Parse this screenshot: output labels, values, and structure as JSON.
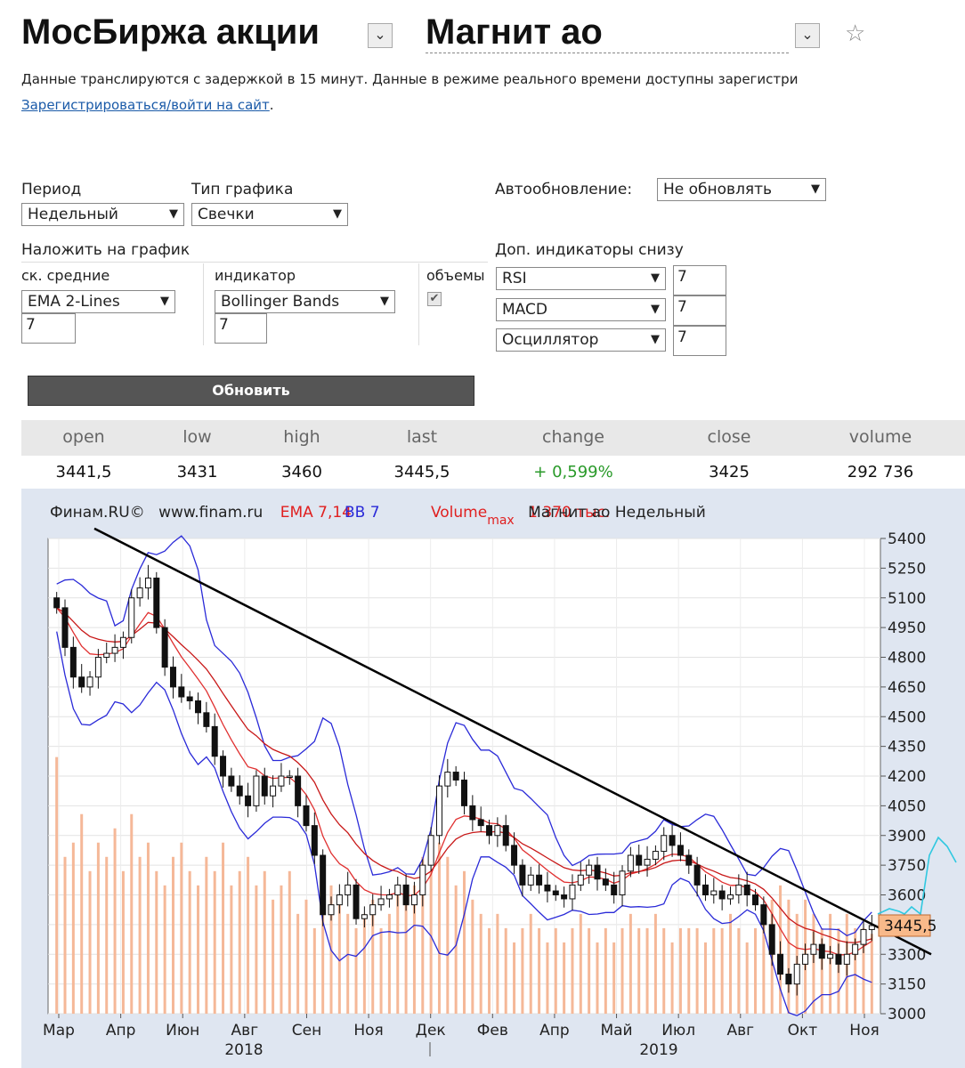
{
  "header": {
    "market_title": "МосБиржа акции",
    "ticker_title": "Магнит ао",
    "dropdown_glyph": "⌄",
    "star_glyph": "☆"
  },
  "notice": {
    "text": "Данные транслируются с задержкой в 15 минут. Данные в режиме реального времени доступны зарегистри",
    "link": "Зарегистрироваться/войти на сайт",
    "link_suffix": "."
  },
  "controls": {
    "period": {
      "label": "Период",
      "value": "Недельный"
    },
    "chart_type": {
      "label": "Тип графика",
      "value": "Свечки"
    },
    "autorefresh": {
      "label": "Автообновление:",
      "value": "Не обновлять"
    },
    "overlay_label": "Наложить на график",
    "ma": {
      "label": "ск. средние",
      "value": "EMA 2-Lines",
      "param": "7"
    },
    "indicator": {
      "label": "индикатор",
      "value": "Bollinger Bands",
      "param": "7"
    },
    "volumes": {
      "label": "объемы",
      "checked": true
    },
    "extra_label": "Доп. индикаторы снизу",
    "extra": [
      {
        "value": "RSI",
        "param": "7"
      },
      {
        "value": "MACD",
        "param": "7"
      },
      {
        "value": "Осциллятор",
        "param": "7"
      }
    ],
    "arrow": "▼",
    "refresh_button": "Обновить"
  },
  "quote": {
    "headers": [
      "open",
      "low",
      "high",
      "last",
      "change",
      "close",
      "volume"
    ],
    "values": [
      "3441,5",
      "3431",
      "3460",
      "3445,5",
      "+ 0,599%",
      "3425",
      "292 736"
    ],
    "change_color": "#2a9a2a"
  },
  "chart_legend": {
    "source": "Финам.RU©",
    "site": "www.finam.ru",
    "ema": "EMA 7,14",
    "bb": "BB 7",
    "volume": "Volume",
    "max": "max",
    "overlap_text": "1 370 тыс.",
    "instrument": "Магнит ао Недельный",
    "last_marker": "3445,5"
  },
  "chart_data": {
    "type": "candlestick",
    "y_ticks": [
      "5400",
      "5250",
      "5100",
      "4950",
      "4800",
      "4650",
      "4500",
      "4350",
      "4200",
      "4050",
      "3900",
      "3750",
      "3600",
      "3450",
      "3300",
      "3150",
      "3000"
    ],
    "x_ticks": [
      "Мар",
      "Апр",
      "Июн",
      "Авг",
      "Сен",
      "Ноя",
      "Дек",
      "Фев",
      "Апр",
      "Май",
      "Июл",
      "Авг",
      "Окт",
      "Ноя"
    ],
    "year_labels": [
      "2018",
      "2019"
    ],
    "ylim": [
      3000,
      5400
    ],
    "trendline": {
      "from": 5450,
      "to": 3300
    },
    "colors": {
      "ema_fast": "#e03030",
      "ema_slow": "#c81818",
      "bb": "#2a2ad8",
      "candle_up": "#ffffff",
      "candle_down": "#111111",
      "volume": "#f5b898",
      "trend": "#000000",
      "indicator": "#30c8e0"
    },
    "closes": [
      5050,
      4850,
      4700,
      4650,
      4700,
      4800,
      4820,
      4850,
      4900,
      5100,
      5150,
      5200,
      4950,
      4750,
      4650,
      4600,
      4580,
      4520,
      4450,
      4300,
      4200,
      4150,
      4100,
      4050,
      4200,
      4100,
      4150,
      4200,
      4200,
      4050,
      3950,
      3800,
      3500,
      3550,
      3600,
      3650,
      3480,
      3500,
      3550,
      3580,
      3600,
      3650,
      3550,
      3600,
      3750,
      3900,
      4150,
      4220,
      4180,
      4050,
      3980,
      3950,
      3900,
      3950,
      3850,
      3750,
      3650,
      3700,
      3650,
      3620,
      3600,
      3580,
      3650,
      3700,
      3750,
      3680,
      3650,
      3600,
      3720,
      3800,
      3750,
      3780,
      3820,
      3900,
      3850,
      3800,
      3750,
      3650,
      3600,
      3620,
      3580,
      3600,
      3650,
      3600,
      3550,
      3450,
      3300,
      3200,
      3150,
      3250,
      3300,
      3350,
      3280,
      3300,
      3250,
      3300,
      3350,
      3425,
      3445
    ],
    "volumes": [
      0.9,
      0.55,
      0.6,
      0.7,
      0.5,
      0.6,
      0.55,
      0.65,
      0.5,
      0.7,
      0.55,
      0.6,
      0.5,
      0.45,
      0.55,
      0.6,
      0.5,
      0.45,
      0.55,
      0.5,
      0.6,
      0.45,
      0.5,
      0.55,
      0.45,
      0.5,
      0.4,
      0.45,
      0.5,
      0.35,
      0.4,
      0.3,
      0.5,
      0.45,
      0.4,
      0.35,
      0.3,
      0.35,
      0.4,
      0.3,
      0.35,
      0.45,
      0.4,
      0.45,
      0.55,
      0.5,
      0.6,
      0.55,
      0.45,
      0.5,
      0.4,
      0.35,
      0.3,
      0.35,
      0.3,
      0.25,
      0.3,
      0.35,
      0.3,
      0.25,
      0.3,
      0.25,
      0.3,
      0.35,
      0.3,
      0.25,
      0.3,
      0.25,
      0.3,
      0.35,
      0.3,
      0.3,
      0.35,
      0.3,
      0.25,
      0.3,
      0.3,
      0.3,
      0.25,
      0.3,
      0.3,
      0.35,
      0.3,
      0.25,
      0.3,
      0.35,
      0.4,
      0.45,
      0.4,
      0.35,
      0.4,
      0.35,
      0.3,
      0.35,
      0.3,
      0.35,
      0.3,
      0.3,
      0.28
    ]
  }
}
